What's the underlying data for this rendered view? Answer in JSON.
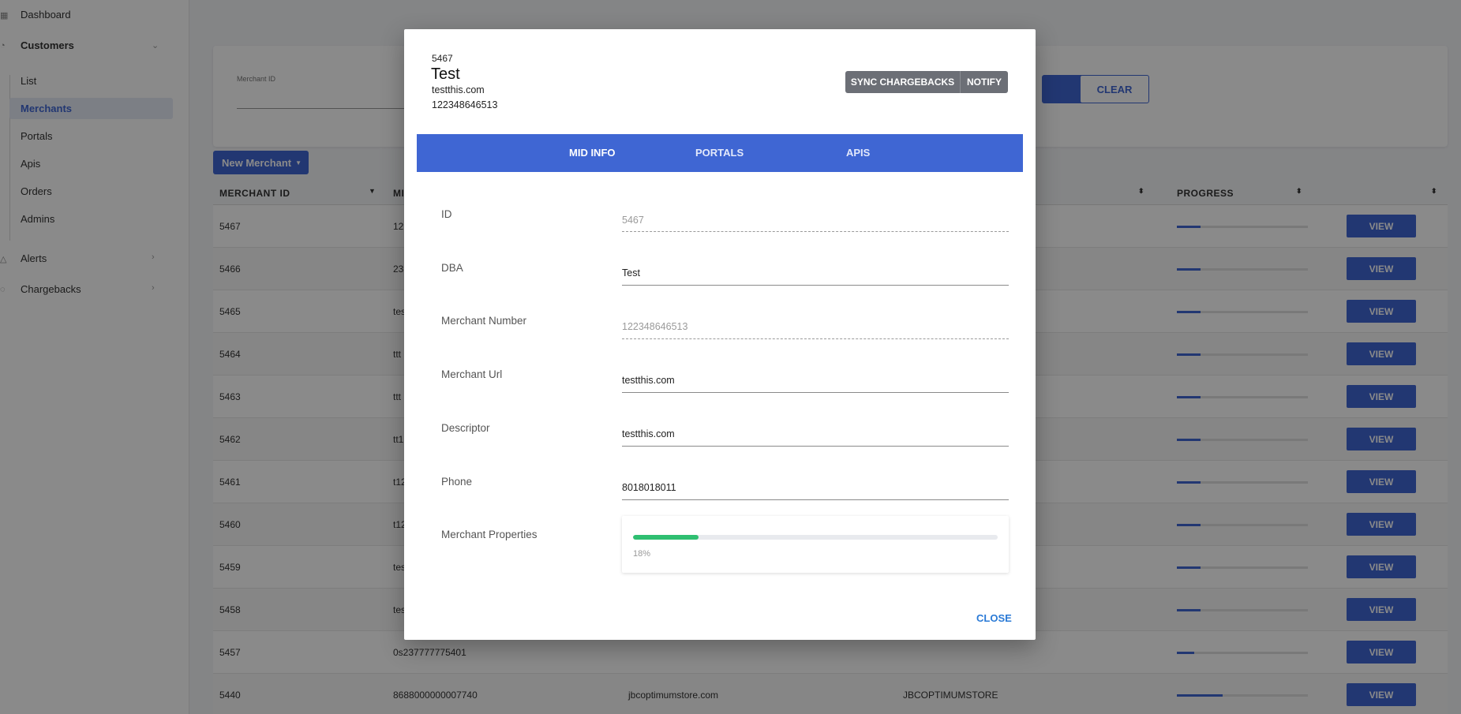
{
  "sidebar": {
    "items": [
      {
        "label": "Dashboard"
      },
      {
        "label": "Customers"
      },
      {
        "label": "List"
      },
      {
        "label": "Merchants"
      },
      {
        "label": "Portals"
      },
      {
        "label": "Apis"
      },
      {
        "label": "Orders"
      },
      {
        "label": "Admins"
      },
      {
        "label": "Alerts"
      },
      {
        "label": "Chargebacks"
      }
    ]
  },
  "filter": {
    "merchant_id_label": "Merchant ID",
    "clear_label": "CLEAR"
  },
  "toolbar": {
    "new_merchant_label": "New Merchant"
  },
  "table": {
    "headers": {
      "merchant_id": "MERCHANT ID",
      "mid": "MI",
      "progress": "PROGRESS"
    },
    "view_label": "VIEW",
    "rows": [
      {
        "id": "5467",
        "mid": "12",
        "url": "",
        "descriptor": "",
        "progress": 0.18
      },
      {
        "id": "5466",
        "mid": "23",
        "url": "",
        "descriptor": "",
        "progress": 0.18
      },
      {
        "id": "5465",
        "mid": "tes",
        "url": "",
        "descriptor": "",
        "progress": 0.18
      },
      {
        "id": "5464",
        "mid": "ttt",
        "url": "",
        "descriptor": "",
        "progress": 0.18
      },
      {
        "id": "5463",
        "mid": "ttt",
        "url": "",
        "descriptor": "",
        "progress": 0.18
      },
      {
        "id": "5462",
        "mid": "tt1",
        "url": "",
        "descriptor": "",
        "progress": 0.18
      },
      {
        "id": "5461",
        "mid": "t12",
        "url": "",
        "descriptor": "",
        "progress": 0.18
      },
      {
        "id": "5460",
        "mid": "t12",
        "url": "",
        "descriptor": "",
        "progress": 0.18
      },
      {
        "id": "5459",
        "mid": "tes",
        "url": "",
        "descriptor": "",
        "progress": 0.18
      },
      {
        "id": "5458",
        "mid": "tes",
        "url": "",
        "descriptor": "",
        "progress": 0.18
      },
      {
        "id": "5457",
        "mid": "0s237777775401",
        "url": "",
        "descriptor": "",
        "progress": 0.13
      },
      {
        "id": "5440",
        "mid": "8688000000007740",
        "url": "jbcoptimumstore.com",
        "descriptor": "JBCOPTIMUMSTORE",
        "progress": 0.35
      }
    ]
  },
  "modal": {
    "id": "5467",
    "title": "Test",
    "url": "testthis.com",
    "number": "122348646513",
    "sync_label": "SYNC CHARGEBACKS",
    "notify_label": "NOTIFY",
    "tabs": [
      {
        "label": "MID INFO"
      },
      {
        "label": "PORTALS"
      },
      {
        "label": "APIS"
      }
    ],
    "fields": {
      "id": {
        "label": "ID",
        "value": "5467"
      },
      "dba": {
        "label": "DBA",
        "value": "Test"
      },
      "merchant_number": {
        "label": "Merchant Number",
        "value": "122348646513"
      },
      "merchant_url": {
        "label": "Merchant Url",
        "value": "testthis.com"
      },
      "descriptor": {
        "label": "Descriptor",
        "value": "testthis.com"
      },
      "phone": {
        "label": "Phone",
        "value": "8018018011"
      },
      "properties": {
        "label": "Merchant Properties",
        "progress": 0.18,
        "percent_text": "18%"
      }
    },
    "close_label": "CLOSE"
  },
  "colors": {
    "accent": "#3f66d3",
    "progress_green": "#2fbf71",
    "link_blue": "#2a7ad6"
  }
}
